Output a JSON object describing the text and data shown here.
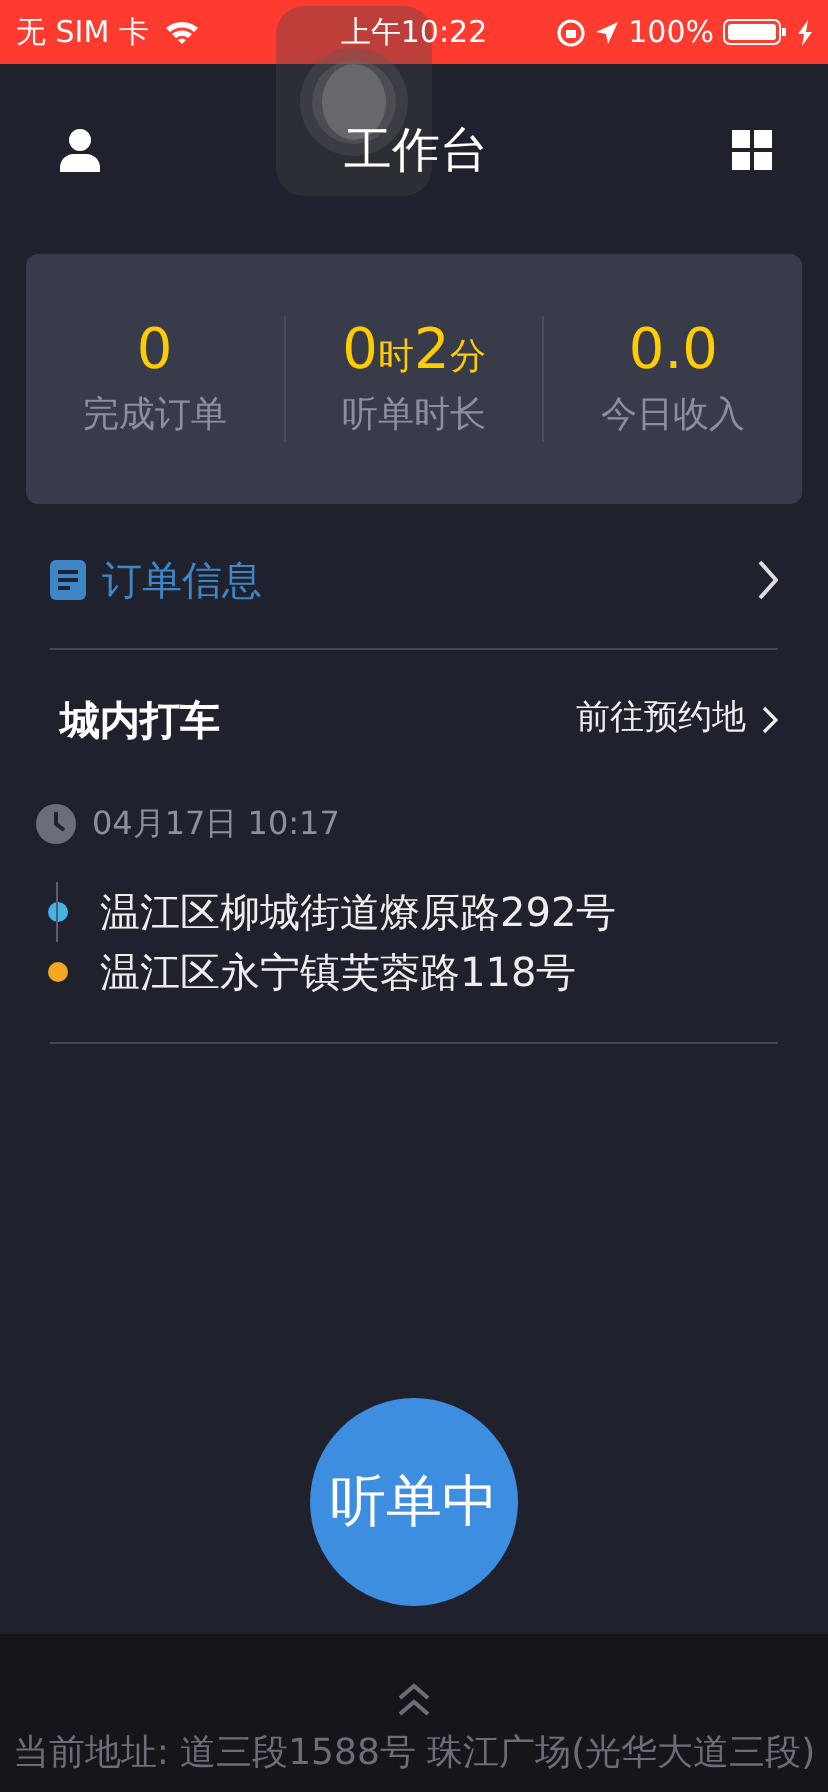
{
  "status_bar": {
    "carrier": "无 SIM 卡",
    "time": "上午10:22",
    "battery": "100%"
  },
  "header": {
    "title": "工作台"
  },
  "stats": [
    {
      "segments": [
        {
          "kind": "number",
          "text": "0"
        }
      ],
      "label": "完成订单"
    },
    {
      "segments": [
        {
          "kind": "number",
          "text": "0"
        },
        {
          "kind": "unit",
          "text": "时"
        },
        {
          "kind": "number",
          "text": "2"
        },
        {
          "kind": "unit",
          "text": "分"
        }
      ],
      "label": "听单时长"
    },
    {
      "segments": [
        {
          "kind": "number",
          "text": "0.0"
        }
      ],
      "label": "今日收入"
    }
  ],
  "order_info": {
    "title": "订单信息"
  },
  "order": {
    "type": "城内打车",
    "action": "前往预约地",
    "time": "04月17日 10:17",
    "stops": [
      {
        "address": "温江区柳城街道燎原路292号",
        "color": "#41b6e6"
      },
      {
        "address": "温江区永宁镇芙蓉路118号",
        "color": "#f5a623"
      }
    ]
  },
  "listen_button": {
    "label": "听单中"
  },
  "footer": {
    "label": "当前地址:",
    "address": "道三段1588号 珠江广场(光华大道三段)"
  }
}
